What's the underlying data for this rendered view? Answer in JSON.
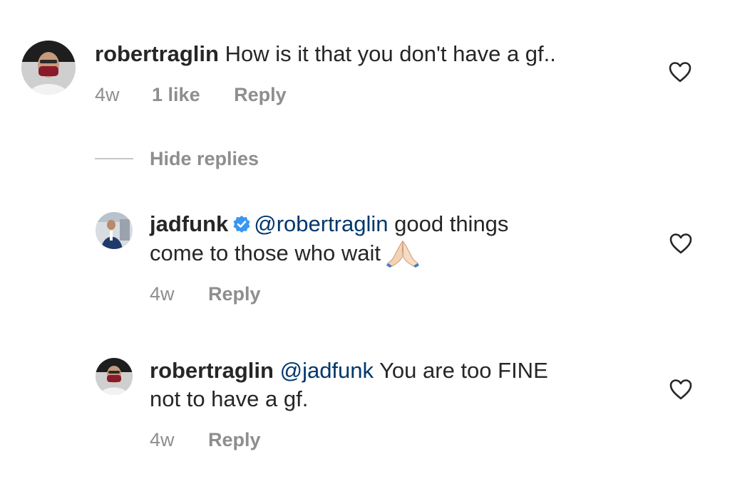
{
  "comments": [
    {
      "username": "robertraglin",
      "text": "How is it that you don't have a gf..",
      "time": "4w",
      "likes": "1 like",
      "reply": "Reply"
    },
    {
      "username": "jadfunk",
      "mention": "@robertraglin",
      "text_line1": " good things",
      "text_line2": "come to those who wait",
      "time": "4w",
      "reply": "Reply"
    },
    {
      "username": "robertraglin",
      "mention": "@jadfunk",
      "text_line1": " You are too FINE",
      "text_line2": "not to have a gf.",
      "time": "4w",
      "reply": "Reply"
    }
  ],
  "thread": {
    "hide_replies": "Hide replies"
  },
  "icons": {
    "like": "heart-icon",
    "verified": "verified-badge-icon",
    "emoji": "folded-hands-emoji"
  },
  "colors": {
    "text": "#262626",
    "secondary": "#8e8e8e",
    "mention": "#00376b",
    "verified": "#3897f0"
  }
}
